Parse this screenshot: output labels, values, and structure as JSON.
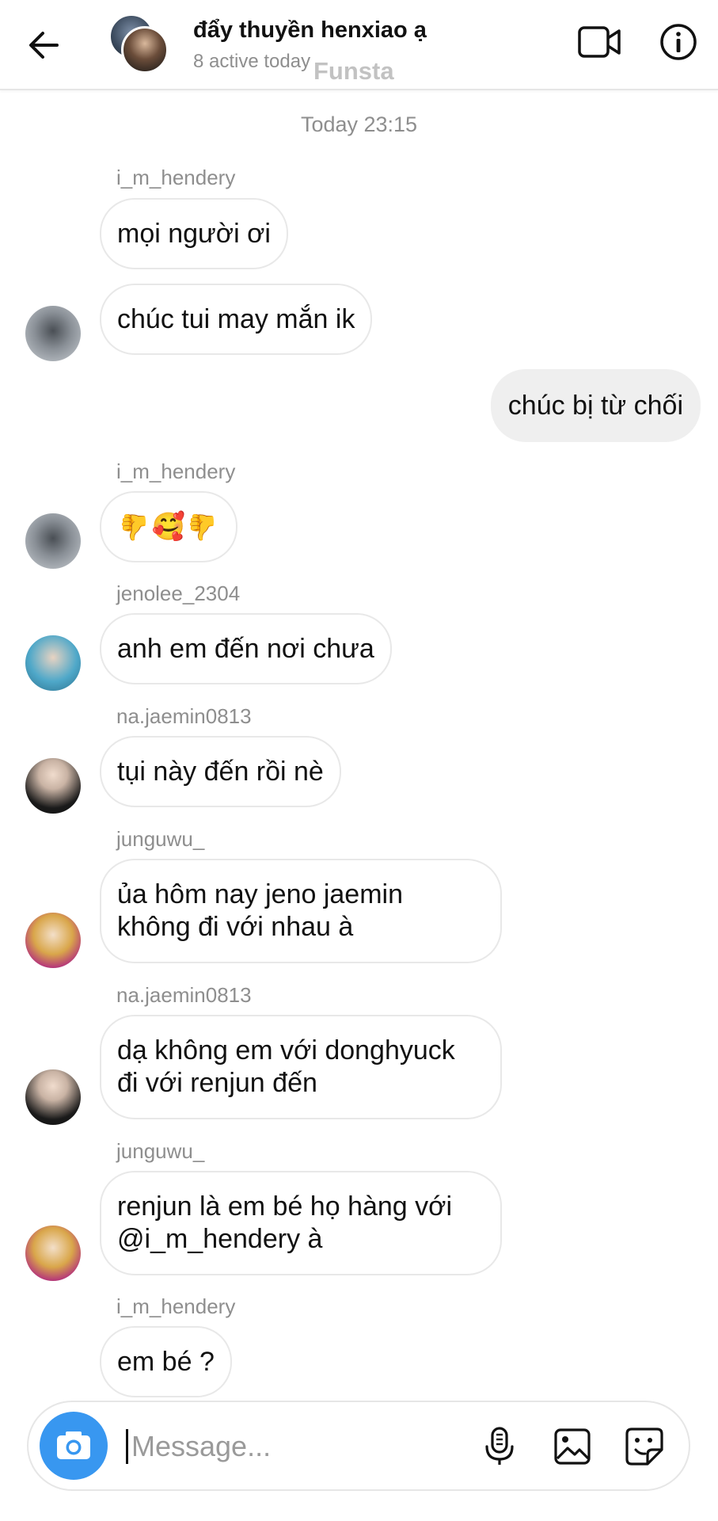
{
  "header": {
    "back_icon": "arrow-left-icon",
    "title": "đẩy thuyền henxiao ạ",
    "subtitle": "8 active today",
    "overlay_text": "Funsta",
    "video_icon": "video-camera-icon",
    "info_icon": "info-icon"
  },
  "timestamp": "Today 23:15",
  "messages": [
    {
      "sender": "i_m_hendery",
      "text": "mọi người ơi"
    },
    {
      "text": "chúc tui may mắn ik"
    },
    {
      "outgoing": true,
      "text": "chúc bị từ chối"
    },
    {
      "sender": "i_m_hendery",
      "emojis": [
        "👍",
        "🥰",
        "👍"
      ]
    },
    {
      "sender": "jenolee_2304",
      "text": "anh em đến nơi chưa"
    },
    {
      "sender": "na.jaemin0813",
      "text": "tụi này đến rồi nè"
    },
    {
      "sender": "junguwu_",
      "text": "ủa hôm nay jeno jaemin\nkhông đi với nhau à"
    },
    {
      "sender": "na.jaemin0813",
      "text": "dạ không em với donghyuck\nđi với renjun đến"
    },
    {
      "sender": "junguwu_",
      "text": "renjun là em bé họ hàng với\n@i_m_hendery à"
    },
    {
      "sender": "i_m_hendery",
      "text": "em bé ?"
    }
  ],
  "composer": {
    "placeholder": "Message...",
    "camera_icon": "camera-icon",
    "mic_icon": "microphone-icon",
    "gallery_icon": "gallery-icon",
    "sticker_icon": "sticker-icon",
    "accent_color": "#3897f0"
  }
}
